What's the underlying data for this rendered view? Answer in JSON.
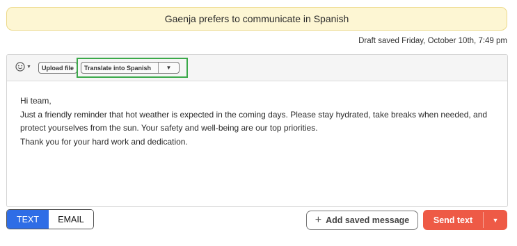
{
  "banner": {
    "text": "Gaenja prefers to communicate in Spanish"
  },
  "draft_status": "Draft saved Friday, October 10th, 7:49 pm",
  "toolbar": {
    "emoji_icon": "smiley-face-icon",
    "upload_label": "Upload file",
    "translate_label": "Translate into Spanish",
    "highlight_color": "#3ba94a"
  },
  "message": {
    "lines": [
      "Hi team,",
      "Just a friendly reminder that hot weather is expected in the coming days. Please stay hydrated, take breaks when needed, and protect yourselves from the sun. Your safety and well-being are our top priorities.",
      "Thank you for your hard work and dedication."
    ]
  },
  "footer": {
    "mode_text": "TEXT",
    "mode_email": "EMAIL",
    "active_mode": "TEXT",
    "add_saved_label": "Add saved message",
    "send_label": "Send text"
  },
  "colors": {
    "banner_bg": "#fdf6d3",
    "active_mode": "#2f6de6",
    "send": "#ee5a46"
  }
}
